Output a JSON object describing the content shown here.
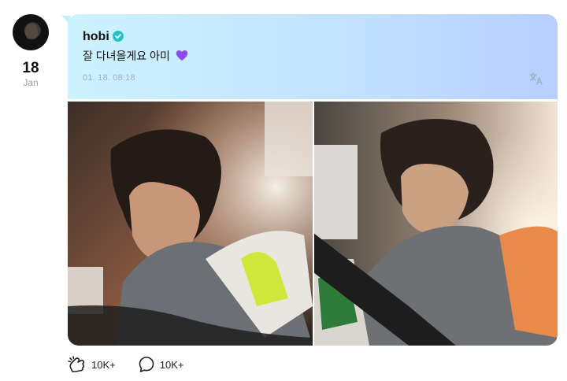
{
  "author": {
    "name": "hobi",
    "avatar_icon": "avatar-icon",
    "verified_icon": "verified-badge-icon",
    "verified_color": "#25c1c9"
  },
  "date": {
    "day": "18",
    "month": "Jan"
  },
  "post": {
    "text": "잘 다녀올게요 아미",
    "emoji": "purple-heart-icon",
    "timestamp": "01. 18. 08:18",
    "translate_icon": "translate-icon",
    "card_gradient": [
      "#cdf2ff",
      "#c2e3ff",
      "#b7ceff"
    ]
  },
  "photos": [
    {
      "alt": "selfie in car, left photo",
      "icon": "photo"
    },
    {
      "alt": "selfie in car, right photo",
      "icon": "photo"
    }
  ],
  "actions": {
    "cheer": {
      "icon": "cheer-icon",
      "count": "10K+"
    },
    "comment": {
      "icon": "comment-icon",
      "count": "10K+"
    }
  }
}
